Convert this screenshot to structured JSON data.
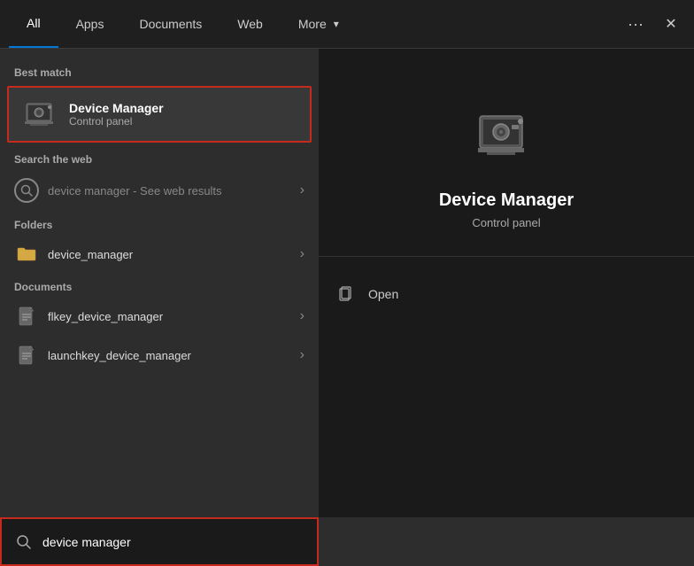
{
  "nav": {
    "tabs": [
      {
        "id": "all",
        "label": "All",
        "active": true
      },
      {
        "id": "apps",
        "label": "Apps",
        "active": false
      },
      {
        "id": "documents",
        "label": "Documents",
        "active": false
      },
      {
        "id": "web",
        "label": "Web",
        "active": false
      },
      {
        "id": "more",
        "label": "More",
        "active": false
      }
    ],
    "dots_label": "···",
    "close_label": "✕"
  },
  "left": {
    "best_match_label": "Best match",
    "best_match": {
      "title": "Device Manager",
      "subtitle": "Control panel"
    },
    "web_search_label": "Search the web",
    "web_search": {
      "text": "device manager",
      "suffix": " - See web results"
    },
    "folders_label": "Folders",
    "folders": [
      {
        "name": "device_manager"
      }
    ],
    "documents_label": "Documents",
    "documents": [
      {
        "name": "flkey_device_manager"
      },
      {
        "name": "launchkey_device_manager"
      }
    ]
  },
  "right": {
    "title": "Device Manager",
    "subtitle": "Control panel",
    "action": "Open"
  },
  "search_bar": {
    "value": "device manager",
    "placeholder": "device manager"
  }
}
